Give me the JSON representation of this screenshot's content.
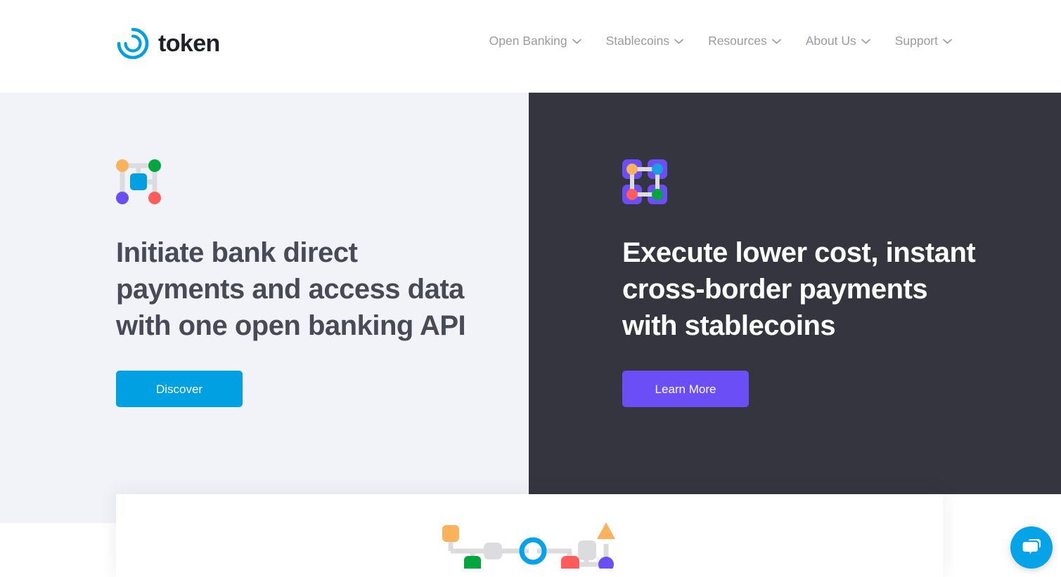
{
  "header": {
    "logo": {
      "icon_name": "token-circular-logo-icon",
      "wordmark": "token",
      "color": "#00a0e3"
    },
    "nav": [
      {
        "label": "Open Banking",
        "icon": "chevron-down-icon"
      },
      {
        "label": "Stablecoins",
        "icon": "chevron-down-icon"
      },
      {
        "label": "Resources",
        "icon": "chevron-down-icon"
      },
      {
        "label": "About Us",
        "icon": "chevron-down-icon"
      },
      {
        "label": "Support",
        "icon": "chevron-down-icon"
      }
    ]
  },
  "panels": {
    "left": {
      "background": "#f2f3f8",
      "icon_name": "network-nodes-icon",
      "headline": "Initiate bank direct\npayments and access data\nwith one open banking API",
      "headline_color": "#474a57",
      "cta": {
        "label": "Discover",
        "color": "#00a0e3"
      }
    },
    "right": {
      "background": "#34353f",
      "icon_name": "stablecoin-network-icon",
      "headline": "Execute lower cost, instant\ncross-border payments\nwith stablecoins",
      "headline_color": "#ffffff",
      "cta": {
        "label": "Learn More",
        "color": "#6b4ef5"
      }
    }
  },
  "flow_card": {
    "icon_name": "payment-flow-diagram",
    "nodes": [
      {
        "name": "orange-square-node",
        "shape": "rounded-square",
        "color": "#fbb25c"
      },
      {
        "name": "green-square-node",
        "shape": "rounded-square",
        "color": "#00a63e"
      },
      {
        "name": "grey-square-node-1",
        "shape": "rounded-square",
        "color": "#dcdcdf"
      },
      {
        "name": "blue-ring-node",
        "shape": "ring",
        "color": "#04a3e9"
      },
      {
        "name": "red-square-node",
        "shape": "rounded-square",
        "color": "#ff5c5c"
      },
      {
        "name": "grey-square-node-2",
        "shape": "rounded-square",
        "color": "#dcdcdf"
      },
      {
        "name": "orange-triangle-node",
        "shape": "triangle",
        "color": "#fbb25c"
      },
      {
        "name": "purple-circle-node",
        "shape": "circle",
        "color": "#6b4ef5"
      }
    ],
    "connector_color": "#dcdcdf"
  },
  "chat_widget": {
    "icon_name": "chat-bubbles-icon",
    "color": "#06a3e8"
  }
}
